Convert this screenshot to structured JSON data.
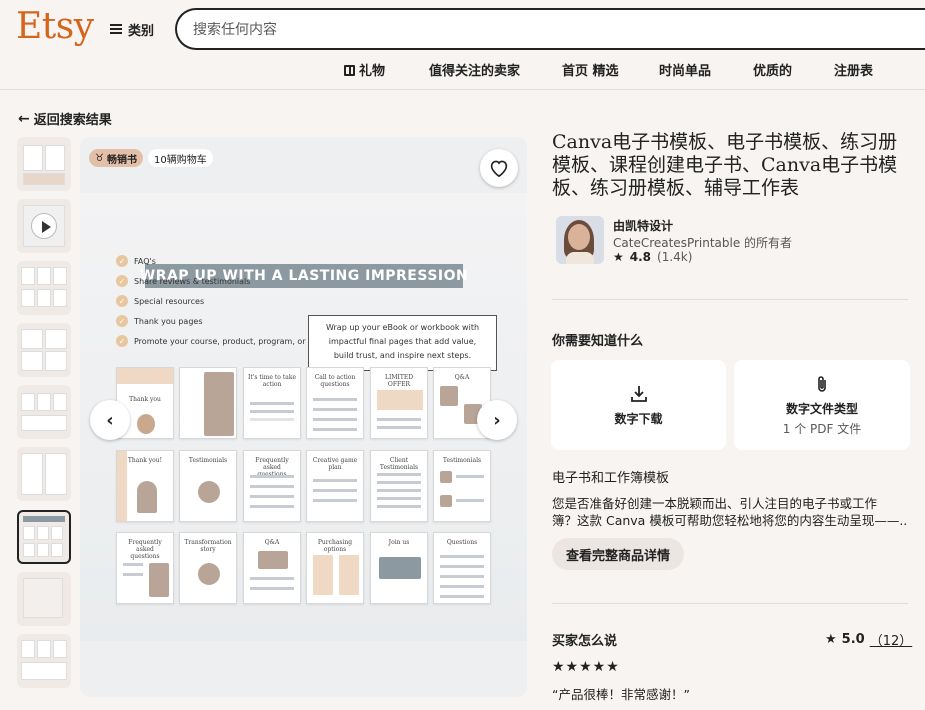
{
  "header": {
    "logo": "Etsy",
    "categories_label": "类别",
    "search_placeholder": "搜索任何内容",
    "nav": [
      "礼物",
      "值得关注的卖家",
      "首页 精选",
      "时尚单品",
      "优质的",
      "注册表"
    ]
  },
  "back_link": "返回搜索结果",
  "gallery": {
    "bestseller_badge": "畅销书",
    "cart_badge": "10辆购物车",
    "banner_text": "WRAP UP WITH A LASTING IMPRESSION",
    "features": [
      "FAQ's",
      "Share reviews & testimonials",
      "Special resources",
      "Thank you pages",
      "Promote your course, product, program,  or services"
    ],
    "callout_lines": [
      "Wrap up your eBook or workbook with",
      "impactful final pages that add value,",
      "build trust, and inspire next steps."
    ],
    "page_titles": [
      "Thank you",
      "",
      "It's time to take action",
      "Call to action questions",
      "LIMITED OFFER",
      "Q&A",
      "Thank you!",
      "Testimonials",
      "Frequently asked questions",
      "Creative game plan",
      "Client Testimonials",
      "Testimonials",
      "Frequently asked questions",
      "Transformation story",
      "Q&A",
      "Purchasing options",
      "Join us",
      "Questions"
    ]
  },
  "listing": {
    "title": "Canva电子书模板、电子书模板、练习册模板、课程创建电子书、Canva电子书模板、练习册模板、辅导工作表",
    "shop_name": "由凯特设计",
    "shop_owner": "CateCreatesPrintable 的所有者",
    "shop_rating": "4.8",
    "shop_rating_count": "(1.4k)",
    "know_heading": "你需要知道什么",
    "card_download": "数字下载",
    "card_filetype": "数字文件类型",
    "card_filetype_sub": "1 个 PDF 文件",
    "desc_heading": "电子书和工作簿模板",
    "desc_line1": "您是否准备好创建一本脱颖而出、引人注目的电子书或工作",
    "desc_line2": "簿？这款 Canva 模板可帮助您轻松地将您的内容生动呈现——...",
    "detail_button": "查看完整商品详情",
    "reviews_heading": "买家怎么说",
    "reviews_score": "5.0",
    "reviews_count": "（12）",
    "review_stars": "★★★★★",
    "review_quote": "“产品很棒！非常感谢！”"
  },
  "colors": {
    "brand": "#d5641c",
    "background": "#f7f4f1",
    "banner": "#8d99a0",
    "accent_tan": "#e6c79f"
  }
}
